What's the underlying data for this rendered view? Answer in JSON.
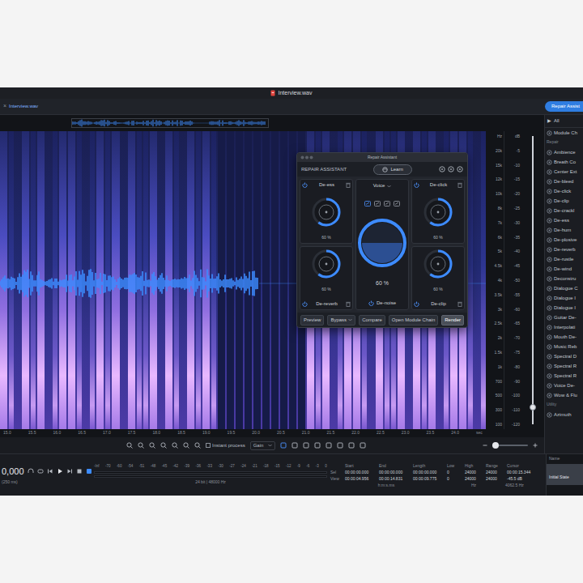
{
  "window": {
    "title": "Interview.wav"
  },
  "tab": {
    "close": "×",
    "label": "Interview.wav"
  },
  "repair_button": "Repair Assist",
  "frequency_scale": [
    "Hz",
    "20k",
    "15k",
    "12k",
    "10k",
    "8k",
    "7k",
    "6k",
    "5k",
    "4.5k",
    "4k",
    "3.5k",
    "3k",
    "2.5k",
    "2k",
    "1.5k",
    "1k",
    "700",
    "500",
    "300",
    "100"
  ],
  "db_scale": [
    "dB",
    "-5",
    "-10",
    "-15",
    "-20",
    "-25",
    "-30",
    "-35",
    "-40",
    "-45",
    "-50",
    "-55",
    "-60",
    "-65",
    "-70",
    "-75",
    "-80",
    "-90",
    "-100",
    "-110",
    "-120"
  ],
  "vertical_zoom": {
    "level": 0.94
  },
  "time_ruler": {
    "ticks": [
      "15.0",
      "15.5",
      "16.0",
      "16.5",
      "17.0",
      "17.5",
      "18.0",
      "18.5",
      "19.0",
      "19.5",
      "20.0",
      "20.5",
      "21.0",
      "21.5",
      "22.0",
      "22.5",
      "23.0",
      "23.5",
      "24.0"
    ],
    "unit": "sec"
  },
  "toolbar": {
    "instant_process": {
      "label": "Instant process",
      "checked": false
    },
    "mode": "Gain",
    "zoom": {
      "level": 0.1
    }
  },
  "repair_assistant": {
    "title": "Repair Assistant",
    "heading": "REPAIR ASSISTANT",
    "learn": "Learn",
    "modules": [
      {
        "name": "De-ess",
        "value": "60 %",
        "level": 0.6,
        "enabled": true
      },
      {
        "name": "De-click",
        "value": "60 %",
        "level": 0.6,
        "enabled": true
      },
      {
        "name": "De-reverb",
        "value": "60 %",
        "level": 0.6,
        "enabled": true
      },
      {
        "name": "De-clip",
        "value": "60 %",
        "level": 0.6,
        "enabled": true
      }
    ],
    "center": {
      "category": "Voice",
      "types": [
        {
          "selected": true
        },
        {
          "selected": false
        },
        {
          "selected": false
        },
        {
          "selected": false
        }
      ],
      "value": "60 %",
      "level": 0.5,
      "name": "De-noise",
      "enabled": true
    },
    "buttons": [
      {
        "label": "Preview",
        "kind": "normal"
      },
      {
        "label": "Bypass",
        "kind": "dropdown"
      },
      {
        "label": "Compare",
        "kind": "normal"
      },
      {
        "label": "Open Module Chain",
        "kind": "normal"
      },
      {
        "label": "Render",
        "kind": "primary"
      }
    ]
  },
  "module_list": {
    "filter": {
      "icon": "▶",
      "label": "All"
    },
    "items": [
      {
        "label": "Module Ch",
        "kind": "module"
      },
      {
        "label": "Repair",
        "kind": "header"
      },
      {
        "label": "Ambience",
        "kind": "module"
      },
      {
        "label": "Breath Co",
        "kind": "module"
      },
      {
        "label": "Center Ext",
        "kind": "module"
      },
      {
        "label": "De-bleed",
        "kind": "module"
      },
      {
        "label": "De-click",
        "kind": "module"
      },
      {
        "label": "De-clip",
        "kind": "module"
      },
      {
        "label": "De-crackl",
        "kind": "module"
      },
      {
        "label": "De-ess",
        "kind": "module"
      },
      {
        "label": "De-hum",
        "kind": "module"
      },
      {
        "label": "De-plosive",
        "kind": "module"
      },
      {
        "label": "De-reverb",
        "kind": "module"
      },
      {
        "label": "De-rustle",
        "kind": "module"
      },
      {
        "label": "De-wind",
        "kind": "module"
      },
      {
        "label": "Deconstru",
        "kind": "module"
      },
      {
        "label": "Dialogue C",
        "kind": "module"
      },
      {
        "label": "Dialogue I",
        "kind": "module"
      },
      {
        "label": "Dialogue I",
        "kind": "module"
      },
      {
        "label": "Guitar De-",
        "kind": "module"
      },
      {
        "label": "Interpolati",
        "kind": "module"
      },
      {
        "label": "Mouth De-",
        "kind": "module"
      },
      {
        "label": "Music Reb",
        "kind": "module"
      },
      {
        "label": "Spectral D",
        "kind": "module"
      },
      {
        "label": "Spectral R",
        "kind": "module"
      },
      {
        "label": "Spectral R",
        "kind": "module"
      },
      {
        "label": "Voice De-",
        "kind": "module"
      },
      {
        "label": "Wow & Flu",
        "kind": "module"
      },
      {
        "label": "Utility",
        "kind": "header"
      },
      {
        "label": "Azimuth",
        "kind": "module"
      }
    ]
  },
  "transport": {
    "time": "0,000",
    "caption": "(250 ms)"
  },
  "meter": {
    "ticks": [
      "-Inf",
      "-70",
      "-60",
      "-54",
      "-51",
      "-48",
      "-45",
      "-42",
      "-39",
      "-36",
      "-33",
      "-30",
      "-27",
      "-24",
      "-21",
      "-18",
      "-15",
      "-12",
      "-9",
      "-6",
      "-3",
      "0"
    ],
    "channels": [
      {
        "level": 0
      },
      {
        "level": 0
      }
    ],
    "format": "24 bit | 48000 Hz"
  },
  "selection": {
    "columns": [
      "",
      "Start",
      "End",
      "Length",
      "Low",
      "High",
      "Range",
      "Cursor"
    ],
    "rows": [
      [
        "Sel",
        "00:00:00.000",
        "00:00:00.000",
        "00:00:00.000",
        "0",
        "24000",
        "24000",
        "00:00:15.344"
      ],
      [
        "View",
        "00:00:04.956",
        "00:00:14.831",
        "00:00:09.775",
        "0",
        "24000",
        "24000",
        "-45.5 dB"
      ]
    ],
    "units": {
      "time": "h:m:s.ms",
      "frequency": "Hz",
      "cursor": "4062.5 Hz"
    }
  },
  "history": {
    "header": "Name",
    "items": [
      {
        "label": "Initial State",
        "selected": true
      }
    ]
  }
}
